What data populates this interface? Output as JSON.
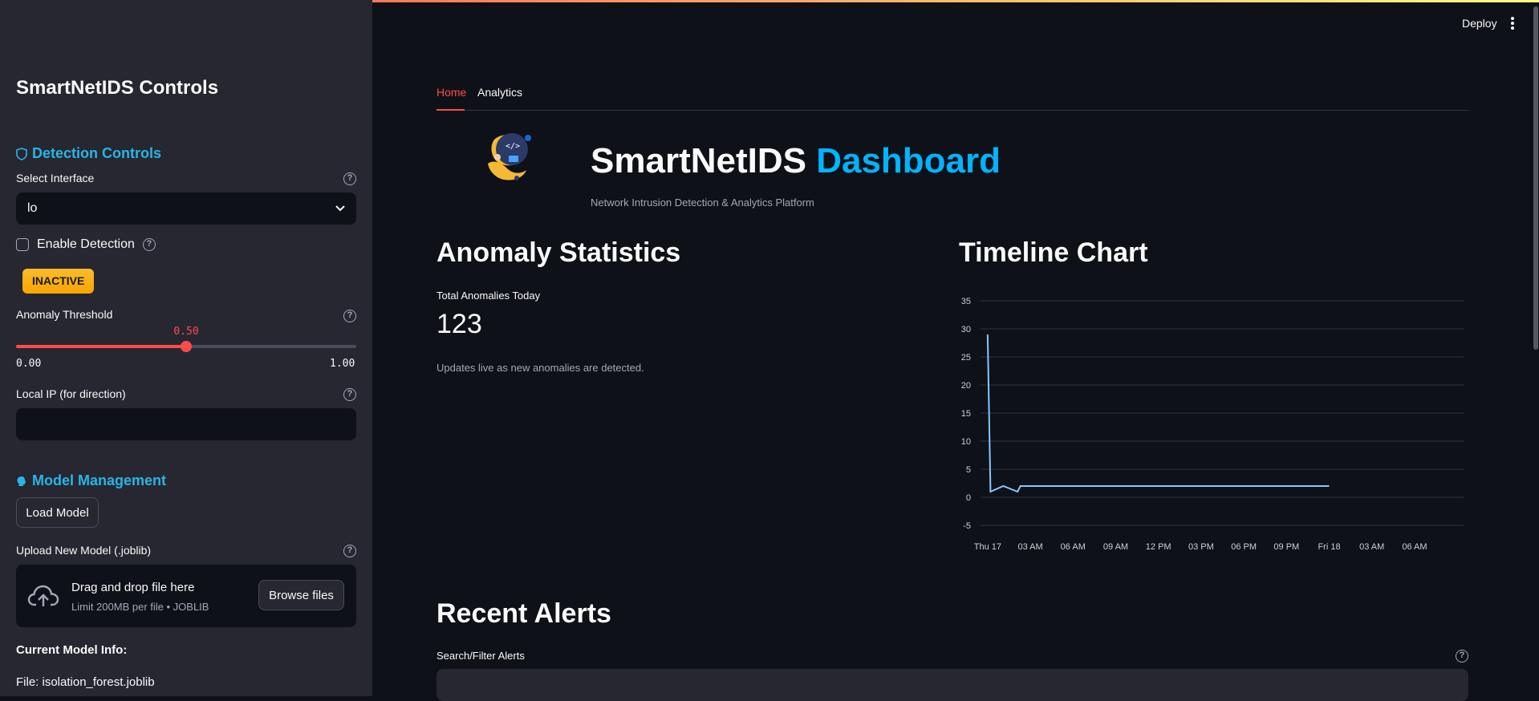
{
  "sidebar": {
    "title": "SmartNetIDS Controls",
    "detection_section": "Detection Controls",
    "select_interface_label": "Select Interface",
    "interface_value": "lo",
    "enable_detection_label": "Enable Detection",
    "status_badge": "INACTIVE",
    "threshold_label": "Anomaly Threshold",
    "threshold_value": 0.5,
    "threshold_value_text": "0.50",
    "threshold_min": "0.00",
    "threshold_max": "1.00",
    "local_ip_label": "Local IP (for direction)",
    "local_ip_value": "",
    "model_section": "Model Management",
    "load_model_button": "Load Model",
    "upload_label": "Upload New Model (.joblib)",
    "upload_main": "Drag and drop file here",
    "upload_sub": "Limit 200MB per file • JOBLIB",
    "browse_button": "Browse files",
    "current_model_heading": "Current Model Info:",
    "current_model_file": "File: isolation_forest.joblib"
  },
  "header": {
    "deploy_label": "Deploy"
  },
  "tabs": [
    {
      "label": "Home",
      "active": true
    },
    {
      "label": "Analytics",
      "active": false
    }
  ],
  "dashboard": {
    "title_main": "SmartNetIDS",
    "title_accent": "Dashboard",
    "subtitle": "Network Intrusion Detection & Analytics Platform",
    "logo_text": "</>"
  },
  "stats": {
    "heading": "Anomaly Statistics",
    "metric_label": "Total Anomalies Today",
    "metric_value": "123",
    "caption": "Updates live as new anomalies are detected."
  },
  "timeline": {
    "heading": "Timeline Chart"
  },
  "alerts": {
    "heading": "Recent Alerts",
    "search_label": "Search/Filter Alerts",
    "search_value": ""
  },
  "colors": {
    "accent": "#ff4b4b",
    "dashboard_accent": "#00b4ff",
    "line": "#83c9ff",
    "section": "#29b5e8",
    "badge": "#f7a500"
  },
  "chart_data": {
    "type": "line",
    "title": "",
    "xlabel": "",
    "ylabel": "",
    "x_ticks": [
      "Thu 17",
      "03 AM",
      "06 AM",
      "09 AM",
      "12 PM",
      "03 PM",
      "06 PM",
      "09 PM",
      "Fri 18",
      "03 AM",
      "06 AM"
    ],
    "y_ticks": [
      -5,
      0,
      5,
      10,
      15,
      20,
      25,
      30,
      35
    ],
    "ylim": [
      -5,
      35
    ],
    "x_unit": "hours since Thu 17 00:00",
    "xlim": [
      -0.5,
      33.5
    ],
    "grid": true,
    "series": [
      {
        "name": "",
        "x": [
          0,
          0.2,
          1.1,
          2.1,
          2.3,
          24
        ],
        "y": [
          29,
          1,
          2,
          1,
          2,
          2
        ]
      }
    ]
  }
}
